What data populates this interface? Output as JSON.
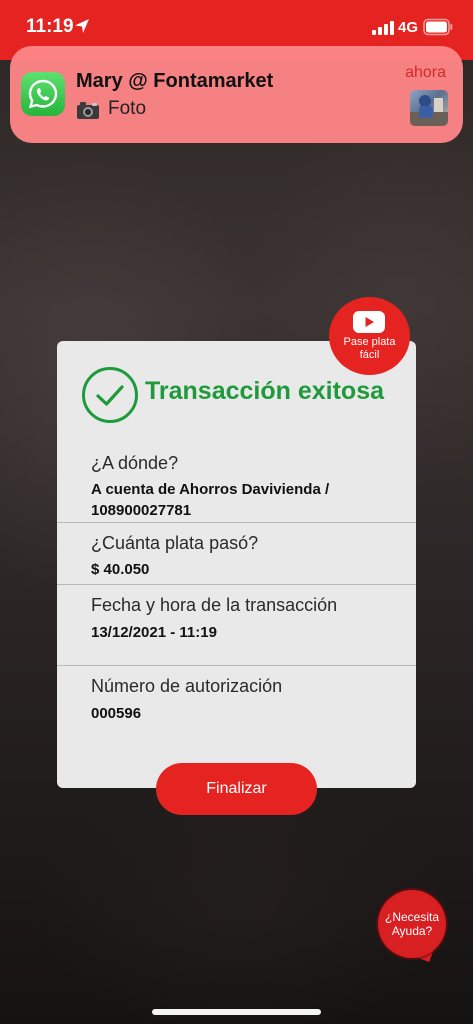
{
  "status_bar": {
    "time": "11:19",
    "network": "4G",
    "background_color": "#e52421"
  },
  "notification": {
    "app_icon": "whatsapp-icon",
    "title": "Mary @ Fontamarket",
    "time": "ahora",
    "body_icon": "camera-icon",
    "body": "Foto"
  },
  "video_badge": {
    "icon": "youtube-play-icon",
    "label_line1": "Pase plata",
    "label_line2": "fácil"
  },
  "card": {
    "status_icon": "check-circle-icon",
    "title": "Transacción exitosa",
    "title_color": "#1e9a3b",
    "destination": {
      "label": "¿A dónde?",
      "value_line1": "A cuenta de Ahorros Davivienda /",
      "value_line2": "108900027781"
    },
    "amount": {
      "label": "¿Cuánta plata pasó?",
      "value": "$ 40.050"
    },
    "datetime": {
      "label": "Fecha y hora de la transacción",
      "value": "13/12/2021 - 11:19"
    },
    "authorization": {
      "label": "Número de autorización",
      "value": "000596"
    }
  },
  "actions": {
    "finish_label": "Finalizar",
    "accent_color": "#e52421"
  },
  "help": {
    "line1": "¿Necesita",
    "line2": "Ayuda?"
  }
}
